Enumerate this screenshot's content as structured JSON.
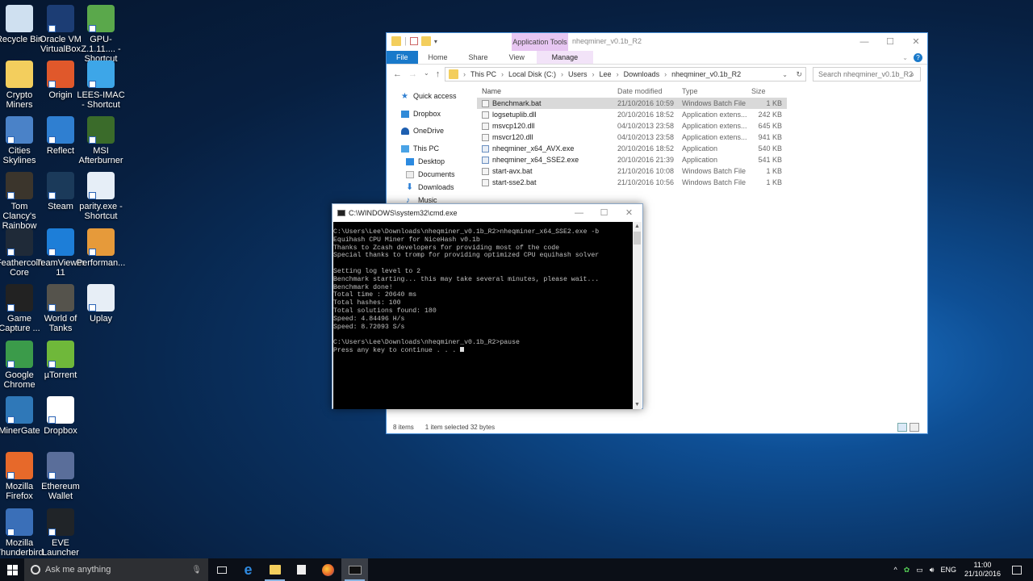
{
  "desktop": {
    "icons": [
      {
        "label": "Recycle Bin",
        "color": "#cfe0f0"
      },
      {
        "label": "Oracle VM VirtualBox",
        "color": "#1c3d74"
      },
      {
        "label": "GPU-Z.1.11.... - Shortcut",
        "color": "#5aa84b"
      },
      {
        "label": "Crypto Miners",
        "color": "#f3ce5d"
      },
      {
        "label": "Origin",
        "color": "#e0582b"
      },
      {
        "label": "LEES-IMAC - Shortcut",
        "color": "#3da6e8"
      },
      {
        "label": "Cities Skylines",
        "color": "#4a82c8"
      },
      {
        "label": "Reflect",
        "color": "#2f7fd1"
      },
      {
        "label": "MSI Afterburner",
        "color": "#3a6b2a"
      },
      {
        "label": "Tom Clancy's Rainbow Si...",
        "color": "#3b352c"
      },
      {
        "label": "Steam",
        "color": "#1b3a5a"
      },
      {
        "label": "parity.exe - Shortcut",
        "color": "#e6eef7"
      },
      {
        "label": "Feathercoin Core",
        "color": "#1f2a38"
      },
      {
        "label": "TeamViewer 11",
        "color": "#1d7ed8"
      },
      {
        "label": "Performan...",
        "color": "#e69a3a"
      },
      {
        "label": "Game Capture ...",
        "color": "#222222"
      },
      {
        "label": "World of Tanks",
        "color": "#55534c"
      },
      {
        "label": "Uplay",
        "color": "#e7eef6"
      },
      {
        "label": "Google Chrome",
        "color": "#3b9b4a"
      },
      {
        "label": "µTorrent",
        "color": "#6fb83a"
      },
      {
        "label": "MinerGate",
        "color": "#2f78b8"
      },
      {
        "label": "Dropbox",
        "color": "#ffffff"
      },
      {
        "label": "Mozilla Firefox",
        "color": "#e7692a"
      },
      {
        "label": "Ethereum Wallet",
        "color": "#5a6e9a"
      },
      {
        "label": "Mozilla Thunderbird",
        "color": "#3a6fb8"
      },
      {
        "label": "EVE Launcher",
        "color": "#202428"
      }
    ]
  },
  "explorer": {
    "title": "nheqminer_v0.1b_R2",
    "context_tab": "Application Tools",
    "ribbon_tabs": [
      "File",
      "Home",
      "Share",
      "View",
      "Manage"
    ],
    "breadcrumb": [
      "This PC",
      "Local Disk (C:)",
      "Users",
      "Lee",
      "Downloads",
      "nheqminer_v0.1b_R2"
    ],
    "search_placeholder": "Search nheqminer_v0.1b_R2",
    "nav_pane": [
      "Quick access",
      "Dropbox",
      "OneDrive",
      "This PC",
      "Desktop",
      "Documents",
      "Downloads",
      "Music"
    ],
    "columns": [
      "Name",
      "Date modified",
      "Type",
      "Size"
    ],
    "files": [
      {
        "name": "Benchmark.bat",
        "date": "21/10/2016 10:59",
        "type": "Windows Batch File",
        "size": "1 KB",
        "kind": "bat",
        "selected": true
      },
      {
        "name": "logsetuplib.dll",
        "date": "20/10/2016 18:52",
        "type": "Application extens...",
        "size": "242 KB",
        "kind": "dll"
      },
      {
        "name": "msvcp120.dll",
        "date": "04/10/2013 23:58",
        "type": "Application extens...",
        "size": "645 KB",
        "kind": "dll"
      },
      {
        "name": "msvcr120.dll",
        "date": "04/10/2013 23:58",
        "type": "Application extens...",
        "size": "941 KB",
        "kind": "dll"
      },
      {
        "name": "nheqminer_x64_AVX.exe",
        "date": "20/10/2016 18:52",
        "type": "Application",
        "size": "540 KB",
        "kind": "exe"
      },
      {
        "name": "nheqminer_x64_SSE2.exe",
        "date": "20/10/2016 21:39",
        "type": "Application",
        "size": "541 KB",
        "kind": "exe"
      },
      {
        "name": "start-avx.bat",
        "date": "21/10/2016 10:08",
        "type": "Windows Batch File",
        "size": "1 KB",
        "kind": "bat"
      },
      {
        "name": "start-sse2.bat",
        "date": "21/10/2016 10:56",
        "type": "Windows Batch File",
        "size": "1 KB",
        "kind": "bat"
      }
    ],
    "status_items": "8 items",
    "status_selected": "1 item selected  32 bytes"
  },
  "cmd": {
    "title": "C:\\WINDOWS\\system32\\cmd.exe",
    "lines": [
      "C:\\Users\\Lee\\Downloads\\nheqminer_v0.1b_R2>nheqminer_x64_SSE2.exe -b",
      "Equihash CPU Miner for NiceHash v0.1b",
      "Thanks to Zcash developers for providing most of the code",
      "Special thanks to tromp for providing optimized CPU equihash solver",
      "",
      "Setting log level to 2",
      "Benchmark starting... this may take several minutes, please wait...",
      "Benchmark done!",
      "Total time : 20640 ms",
      "Total hashes: 100",
      "Total solutions found: 180",
      "Speed: 4.84496 H/s",
      "Speed: 8.72093 S/s",
      "",
      "C:\\Users\\Lee\\Downloads\\nheqminer_v0.1b_R2>pause"
    ],
    "prompt_line": "Press any key to continue . . . "
  },
  "taskbar": {
    "search_placeholder": "Ask me anything",
    "language": "ENG",
    "time": "11:00",
    "date": "21/10/2016"
  }
}
